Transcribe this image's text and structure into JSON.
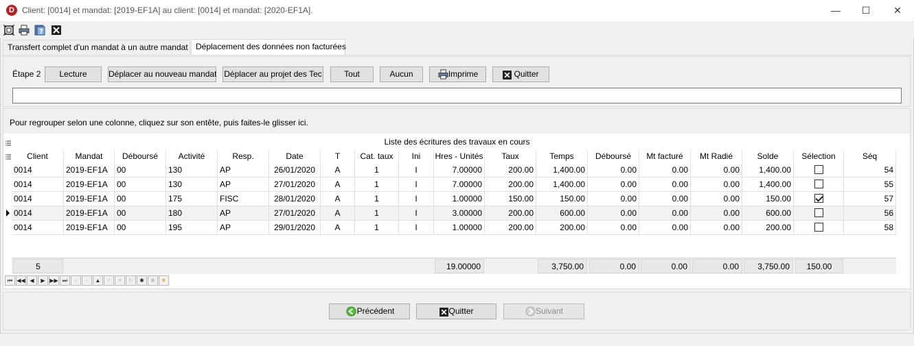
{
  "window": {
    "title": "Client: [0014]  et mandat: [2019-EF1A]  au client: [0014]  et mandat: [2020-EF1A].",
    "minimize": "—",
    "maximize": "☐",
    "close": "✕"
  },
  "toolbar": {
    "icons": [
      "fullscreen-icon",
      "print-icon",
      "help-icon",
      "close-icon"
    ]
  },
  "tabs": [
    {
      "label": "Transfert complet d'un mandat à un autre mandat"
    },
    {
      "label": "Déplacement des données non facturées"
    }
  ],
  "step": {
    "label": "Étape 2",
    "buttons": {
      "lecture": "Lecture",
      "move_new_mandate": "Déplacer au nouveau mandat",
      "move_project": "Déplacer au projet des Tec",
      "all": "Tout",
      "none": "Aucun",
      "print": "Imprime",
      "quit": "Quitter"
    },
    "message": ""
  },
  "grid": {
    "group_hint": "Pour regrouper selon une colonne, cliquez sur son entête, puis faites-le glisser ici.",
    "title": "Liste des écritures des travaux en cours",
    "columns": [
      "Client",
      "Mandat",
      "Déboursé",
      "Activité",
      "Resp.",
      "Date",
      "T",
      "Cat. taux",
      "Ini",
      "Hres - Unités",
      "Taux",
      "Temps",
      "Déboursé",
      "Mt facturé",
      "Mt Radié",
      "Solde",
      "Sélection",
      "Séq"
    ],
    "rows": [
      {
        "client": "0014",
        "mandat": "2019-EF1A",
        "debourse": "00",
        "activite": "130",
        "resp": "AP",
        "date": "26/01/2020",
        "t": "A",
        "cat": "1",
        "ini": "I",
        "hres": "7.00000",
        "taux": "200.00",
        "temps": "1,400.00",
        "debourse_amt": "0.00",
        "mt_facture": "0.00",
        "mt_radie": "0.00",
        "solde": "1,400.00",
        "selected": false,
        "seq": "54"
      },
      {
        "client": "0014",
        "mandat": "2019-EF1A",
        "debourse": "00",
        "activite": "130",
        "resp": "AP",
        "date": "27/01/2020",
        "t": "A",
        "cat": "1",
        "ini": "I",
        "hres": "7.00000",
        "taux": "200.00",
        "temps": "1,400.00",
        "debourse_amt": "0.00",
        "mt_facture": "0.00",
        "mt_radie": "0.00",
        "solde": "1,400.00",
        "selected": false,
        "seq": "55"
      },
      {
        "client": "0014",
        "mandat": "2019-EF1A",
        "debourse": "00",
        "activite": "175",
        "resp": "FISC",
        "date": "28/01/2020",
        "t": "A",
        "cat": "1",
        "ini": "I",
        "hres": "1.00000",
        "taux": "150.00",
        "temps": "150.00",
        "debourse_amt": "0.00",
        "mt_facture": "0.00",
        "mt_radie": "0.00",
        "solde": "150.00",
        "selected": true,
        "seq": "57"
      },
      {
        "client": "0014",
        "mandat": "2019-EF1A",
        "debourse": "00",
        "activite": "180",
        "resp": "AP",
        "date": "27/01/2020",
        "t": "A",
        "cat": "1",
        "ini": "I",
        "hres": "3.00000",
        "taux": "200.00",
        "temps": "600.00",
        "debourse_amt": "0.00",
        "mt_facture": "0.00",
        "mt_radie": "0.00",
        "solde": "600.00",
        "selected": false,
        "seq": "56"
      },
      {
        "client": "0014",
        "mandat": "2019-EF1A",
        "debourse": "00",
        "activite": "195",
        "resp": "AP",
        "date": "29/01/2020",
        "t": "A",
        "cat": "1",
        "ini": "I",
        "hres": "1.00000",
        "taux": "200.00",
        "temps": "200.00",
        "debourse_amt": "0.00",
        "mt_facture": "0.00",
        "mt_radie": "0.00",
        "solde": "200.00",
        "selected": false,
        "seq": "58"
      }
    ],
    "current_row": 3,
    "totals": {
      "count": "5",
      "hres": "19.00000",
      "temps": "3,750.00",
      "debourse": "0.00",
      "mt_facture": "0.00",
      "mt_radie": "0.00",
      "solde": "3,750.00",
      "selection": "150.00"
    }
  },
  "navigator": {
    "icons": [
      "first-icon",
      "prev-page-icon",
      "prev-icon",
      "next-icon",
      "next-page-icon",
      "last-icon",
      "insert-icon",
      "delete-icon",
      "edit-icon",
      "post-icon",
      "cancel-icon",
      "refresh-icon",
      "bookmark-icon",
      "goto-bookmark-icon",
      "filter-icon"
    ]
  },
  "bottom": {
    "previous": "Précédent",
    "quit": "Quitter",
    "next": "Suivant"
  }
}
